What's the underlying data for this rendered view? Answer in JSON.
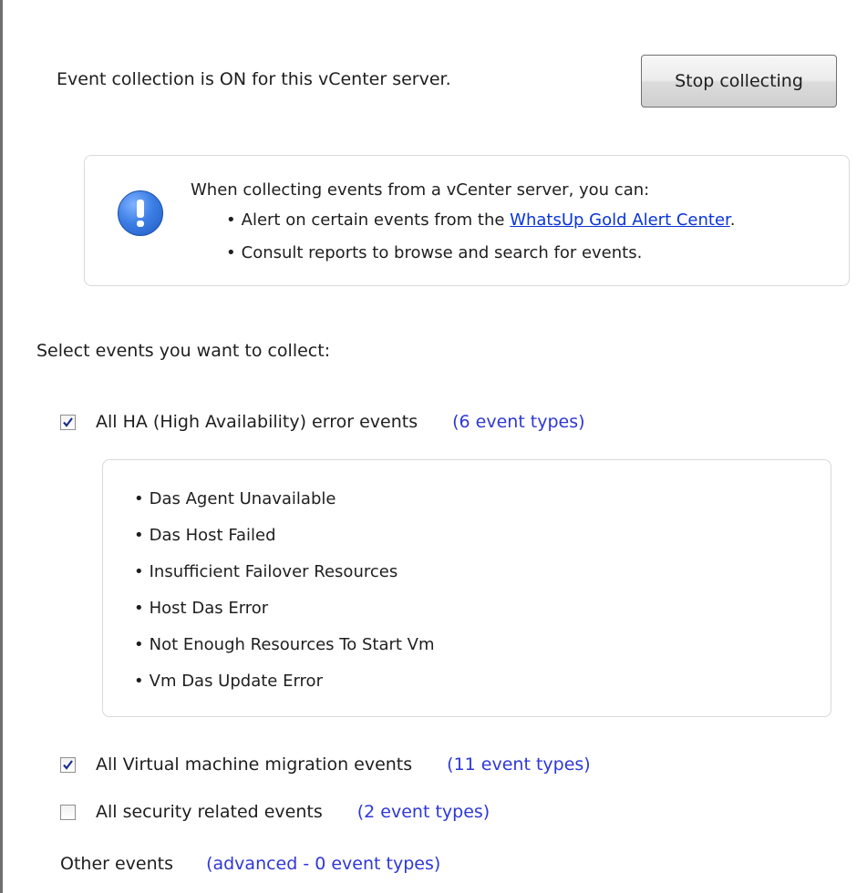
{
  "header": {
    "status_text": "Event collection is ON for this vCenter server.",
    "stop_button_label": "Stop collecting"
  },
  "info": {
    "icon": "exclamation-info-icon",
    "heading": "When collecting events from a vCenter server, you can:",
    "line1_prefix": "Alert on certain events from the ",
    "line1_link": "WhatsUp Gold Alert Center",
    "line1_suffix": ".",
    "line2": "Consult reports to browse and search for events.",
    "bullet": "•"
  },
  "select_label": "Select events you want to collect:",
  "groups": [
    {
      "label": "All HA (High Availability) error events",
      "count": "(6 event types)",
      "checked": true
    },
    {
      "label": "All Virtual machine migration events",
      "count": "(11 event types)",
      "checked": true
    },
    {
      "label": "All security related events",
      "count": "(2 event types)",
      "checked": false
    }
  ],
  "ha_events": [
    "Das Agent Unavailable",
    "Das Host Failed",
    "Insufficient Failover Resources",
    "Host Das Error",
    "Not Enough Resources To Start Vm",
    "Vm Das Update Error"
  ],
  "other": {
    "label": "Other events",
    "link": "(advanced - 0 event types)"
  },
  "colors": {
    "link": "#0a34d8",
    "count": "#2e37d8",
    "check": "#1b2f8c"
  }
}
